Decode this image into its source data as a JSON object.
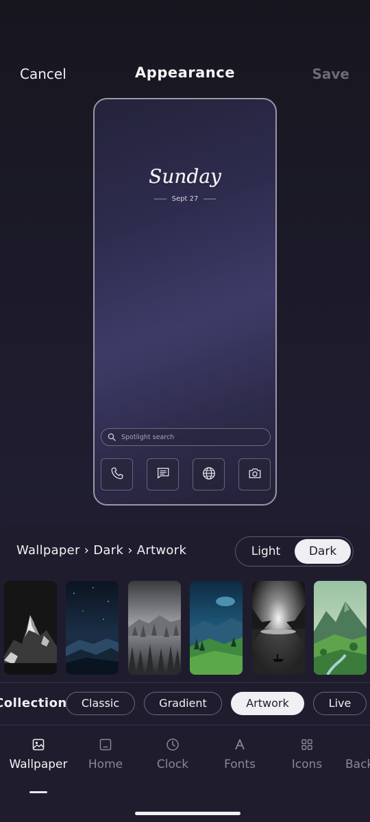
{
  "header": {
    "cancel_label": "Cancel",
    "title": "Appearance",
    "save_label": "Save"
  },
  "preview": {
    "day": "Sunday",
    "date": "Sept 27",
    "search_placeholder": "Spotlight search",
    "dock_icons": [
      "phone-icon",
      "messages-icon",
      "globe-icon",
      "camera-icon"
    ]
  },
  "sheet": {
    "breadcrumb": "Wallpaper › Dark › Artwork",
    "mode_options": {
      "light": "Light",
      "dark": "Dark",
      "selected": "Dark"
    },
    "wallpapers": [
      "snowy-mountain-wallpaper",
      "starry-night-wallpaper",
      "misty-forest-wallpaper",
      "moonlit-valley-wallpaper",
      "lake-boat-wallpaper",
      "green-mountains-wallpaper"
    ],
    "collection_label": "Collection",
    "chips": [
      "Classic",
      "Gradient",
      "Artwork",
      "Live"
    ],
    "selected_chip": "Artwork",
    "tabs": [
      "Wallpaper",
      "Home",
      "Clock",
      "Fonts",
      "Icons",
      "Back"
    ],
    "selected_tab": "Wallpaper"
  },
  "colors": {
    "background": "#1d1b2b",
    "sheet": "#1f1d2d",
    "accent_selected": "#efeef3",
    "muted_text": "#8a8896"
  }
}
